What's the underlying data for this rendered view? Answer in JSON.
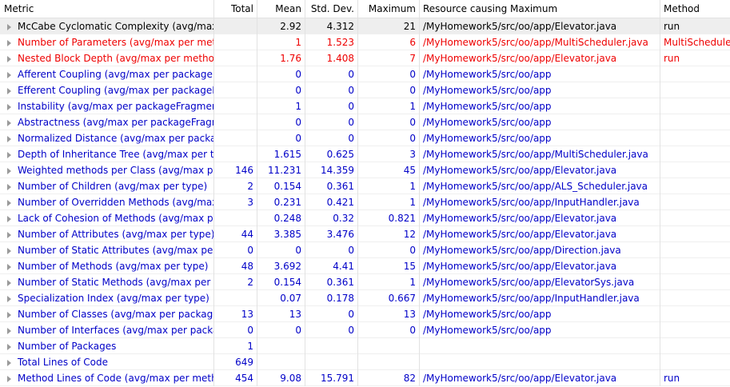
{
  "columns": {
    "metric": "Metric",
    "total": "Total",
    "mean": "Mean",
    "std": "Std. Dev.",
    "max": "Maximum",
    "resource": "Resource causing Maximum",
    "method": "Method"
  },
  "colors": {
    "normal": "#0000c8",
    "violation": "#ee0000",
    "selected": "#000000",
    "selected_bg": "#eeeeee"
  },
  "icons": {
    "expand": "expand-arrow-icon"
  },
  "rows": [
    {
      "metric": "McCabe Cyclomatic Complexity (avg/max",
      "total": "",
      "mean": "2.92",
      "std": "4.312",
      "max": "21",
      "resource": "/MyHomework5/src/oo/app/Elevator.java",
      "method": "run",
      "style": "black",
      "selected": true
    },
    {
      "metric": "Number of Parameters (avg/max per meth",
      "total": "",
      "mean": "1",
      "std": "1.523",
      "max": "6",
      "resource": "/MyHomework5/src/oo/app/MultiScheduler.java",
      "method": "MultiScheduler",
      "style": "red",
      "selected": false
    },
    {
      "metric": "Nested Block Depth (avg/max per methoc",
      "total": "",
      "mean": "1.76",
      "std": "1.408",
      "max": "7",
      "resource": "/MyHomework5/src/oo/app/Elevator.java",
      "method": "run",
      "style": "red",
      "selected": false
    },
    {
      "metric": "Afferent Coupling (avg/max per packageF",
      "total": "",
      "mean": "0",
      "std": "0",
      "max": "0",
      "resource": "/MyHomework5/src/oo/app",
      "method": "",
      "style": "blue",
      "selected": false
    },
    {
      "metric": "Efferent Coupling (avg/max per packageFi",
      "total": "",
      "mean": "0",
      "std": "0",
      "max": "0",
      "resource": "/MyHomework5/src/oo/app",
      "method": "",
      "style": "blue",
      "selected": false
    },
    {
      "metric": "Instability (avg/max per packageFragment",
      "total": "",
      "mean": "1",
      "std": "0",
      "max": "1",
      "resource": "/MyHomework5/src/oo/app",
      "method": "",
      "style": "blue",
      "selected": false
    },
    {
      "metric": "Abstractness (avg/max per packageFragm",
      "total": "",
      "mean": "0",
      "std": "0",
      "max": "0",
      "resource": "/MyHomework5/src/oo/app",
      "method": "",
      "style": "blue",
      "selected": false
    },
    {
      "metric": "Normalized Distance (avg/max per packag",
      "total": "",
      "mean": "0",
      "std": "0",
      "max": "0",
      "resource": "/MyHomework5/src/oo/app",
      "method": "",
      "style": "blue",
      "selected": false
    },
    {
      "metric": "Depth of Inheritance Tree (avg/max per ty",
      "total": "",
      "mean": "1.615",
      "std": "0.625",
      "max": "3",
      "resource": "/MyHomework5/src/oo/app/MultiScheduler.java",
      "method": "",
      "style": "blue",
      "selected": false
    },
    {
      "metric": "Weighted methods per Class (avg/max pe",
      "total": "146",
      "mean": "11.231",
      "std": "14.359",
      "max": "45",
      "resource": "/MyHomework5/src/oo/app/Elevator.java",
      "method": "",
      "style": "blue",
      "selected": false
    },
    {
      "metric": "Number of Children (avg/max per type)",
      "total": "2",
      "mean": "0.154",
      "std": "0.361",
      "max": "1",
      "resource": "/MyHomework5/src/oo/app/ALS_Scheduler.java",
      "method": "",
      "style": "blue",
      "selected": false
    },
    {
      "metric": "Number of Overridden Methods (avg/max",
      "total": "3",
      "mean": "0.231",
      "std": "0.421",
      "max": "1",
      "resource": "/MyHomework5/src/oo/app/InputHandler.java",
      "method": "",
      "style": "blue",
      "selected": false
    },
    {
      "metric": "Lack of Cohesion of Methods (avg/max pe",
      "total": "",
      "mean": "0.248",
      "std": "0.32",
      "max": "0.821",
      "resource": "/MyHomework5/src/oo/app/Elevator.java",
      "method": "",
      "style": "blue",
      "selected": false
    },
    {
      "metric": "Number of Attributes (avg/max per type)",
      "total": "44",
      "mean": "3.385",
      "std": "3.476",
      "max": "12",
      "resource": "/MyHomework5/src/oo/app/Elevator.java",
      "method": "",
      "style": "blue",
      "selected": false
    },
    {
      "metric": "Number of Static Attributes (avg/max per",
      "total": "0",
      "mean": "0",
      "std": "0",
      "max": "0",
      "resource": "/MyHomework5/src/oo/app/Direction.java",
      "method": "",
      "style": "blue",
      "selected": false
    },
    {
      "metric": "Number of Methods (avg/max per type)",
      "total": "48",
      "mean": "3.692",
      "std": "4.41",
      "max": "15",
      "resource": "/MyHomework5/src/oo/app/Elevator.java",
      "method": "",
      "style": "blue",
      "selected": false
    },
    {
      "metric": "Number of Static Methods (avg/max per t",
      "total": "2",
      "mean": "0.154",
      "std": "0.361",
      "max": "1",
      "resource": "/MyHomework5/src/oo/app/ElevatorSys.java",
      "method": "",
      "style": "blue",
      "selected": false
    },
    {
      "metric": "Specialization Index (avg/max per type)",
      "total": "",
      "mean": "0.07",
      "std": "0.178",
      "max": "0.667",
      "resource": "/MyHomework5/src/oo/app/InputHandler.java",
      "method": "",
      "style": "blue",
      "selected": false
    },
    {
      "metric": "Number of Classes (avg/max per package",
      "total": "13",
      "mean": "13",
      "std": "0",
      "max": "13",
      "resource": "/MyHomework5/src/oo/app",
      "method": "",
      "style": "blue",
      "selected": false
    },
    {
      "metric": "Number of Interfaces (avg/max per packa",
      "total": "0",
      "mean": "0",
      "std": "0",
      "max": "0",
      "resource": "/MyHomework5/src/oo/app",
      "method": "",
      "style": "blue",
      "selected": false
    },
    {
      "metric": "Number of Packages",
      "total": "1",
      "mean": "",
      "std": "",
      "max": "",
      "resource": "",
      "method": "",
      "style": "blue",
      "selected": false
    },
    {
      "metric": "Total Lines of Code",
      "total": "649",
      "mean": "",
      "std": "",
      "max": "",
      "resource": "",
      "method": "",
      "style": "blue",
      "selected": false
    },
    {
      "metric": "Method Lines of Code (avg/max per meth",
      "total": "454",
      "mean": "9.08",
      "std": "15.791",
      "max": "82",
      "resource": "/MyHomework5/src/oo/app/Elevator.java",
      "method": "run",
      "style": "blue",
      "selected": false
    }
  ]
}
